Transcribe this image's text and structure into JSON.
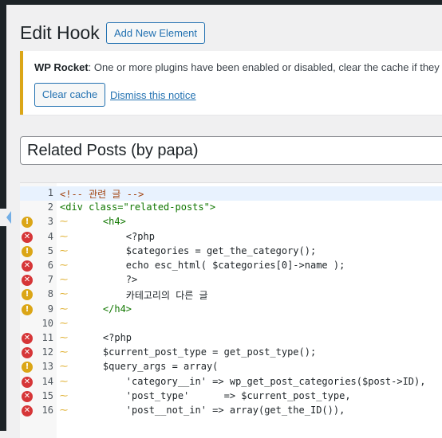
{
  "page": {
    "title": "Edit Hook",
    "add_new_label": "Add New Element"
  },
  "notice": {
    "plugin": "WP Rocket",
    "message": ": One or more plugins have been enabled or disabled, clear the cache if they af",
    "clear_cache_label": "Clear cache",
    "dismiss_label": "Dismiss this notice"
  },
  "title_field": {
    "value": "Related Posts (by papa)"
  },
  "editor": {
    "lines": [
      {
        "num": "1",
        "marker": "",
        "style": "comment",
        "text": "<!-- 관련 글 -->"
      },
      {
        "num": "2",
        "marker": "",
        "style": "tag",
        "text": "<div class=\"related-posts\">"
      },
      {
        "num": "3",
        "marker": "warning",
        "style": "tag",
        "text": "    <h4>"
      },
      {
        "num": "4",
        "marker": "error",
        "style": "plain",
        "text": "        <?php"
      },
      {
        "num": "5",
        "marker": "warning",
        "style": "plain",
        "text": "        $categories = get_the_category();"
      },
      {
        "num": "6",
        "marker": "error",
        "style": "plain",
        "text": "        echo esc_html( $categories[0]->name );"
      },
      {
        "num": "7",
        "marker": "error",
        "style": "plain",
        "text": "        ?>"
      },
      {
        "num": "8",
        "marker": "warning",
        "style": "plain",
        "text": "        카테고리의 다른 글"
      },
      {
        "num": "9",
        "marker": "warning",
        "style": "tag",
        "text": "    </h4>"
      },
      {
        "num": "10",
        "marker": "",
        "style": "plain",
        "text": ""
      },
      {
        "num": "11",
        "marker": "error",
        "style": "plain",
        "text": "    <?php"
      },
      {
        "num": "12",
        "marker": "error",
        "style": "plain",
        "text": "    $current_post_type = get_post_type();"
      },
      {
        "num": "13",
        "marker": "warning",
        "style": "plain",
        "text": "    $query_args = array("
      },
      {
        "num": "14",
        "marker": "error",
        "style": "plain",
        "text": "        'category__in' => wp_get_post_categories($post->ID),"
      },
      {
        "num": "15",
        "marker": "error",
        "style": "plain",
        "text": "        'post_type'      => $current_post_type,"
      },
      {
        "num": "16",
        "marker": "error",
        "style": "plain",
        "text": "        'post__not_in' => array(get_the_ID()),"
      }
    ]
  }
}
